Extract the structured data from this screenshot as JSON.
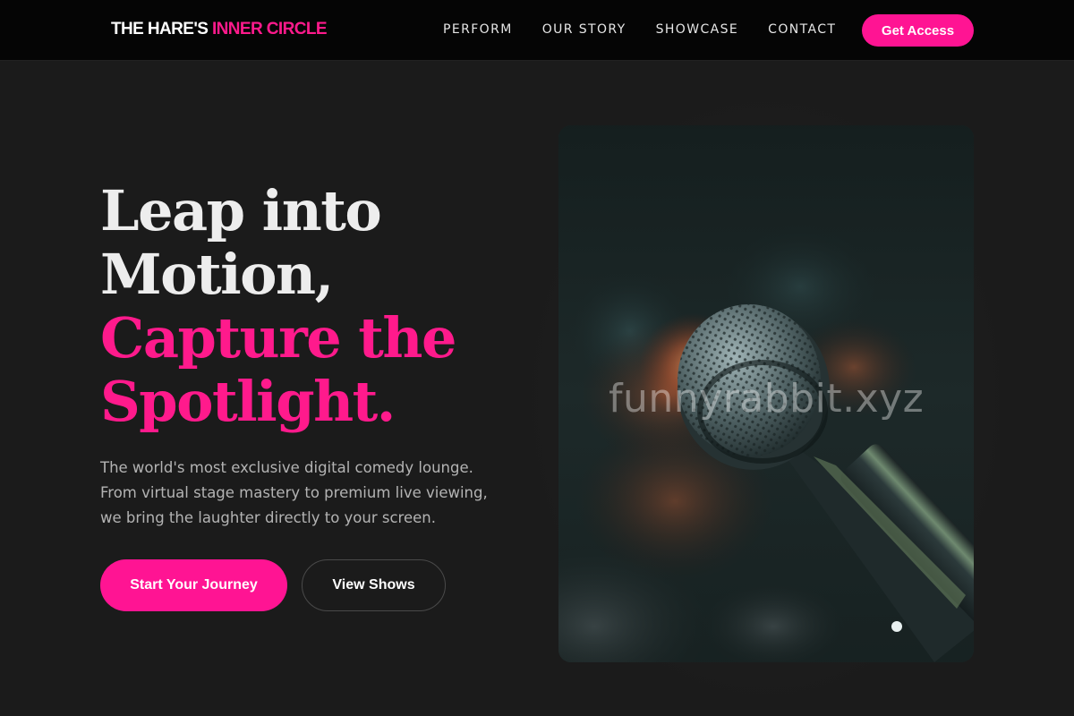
{
  "brand": {
    "name_part1": "THE HARE'S ",
    "name_part2": "INNER CIRCLE"
  },
  "nav": {
    "links": [
      {
        "label": "PERFORM"
      },
      {
        "label": "OUR STORY"
      },
      {
        "label": "SHOWCASE"
      },
      {
        "label": "CONTACT"
      }
    ],
    "cta_label": "Get Access"
  },
  "hero": {
    "headline_line1": "Leap into",
    "headline_line2": "Motion,",
    "headline_line3": "Capture the",
    "headline_line4": "Spotlight.",
    "subtitle_lines": [
      "The world's most exclusive digital comedy lounge.",
      "From virtual stage mastery to premium live viewing,",
      "we bring the laughter directly to your screen."
    ],
    "primary_button": "Start Your Journey",
    "secondary_button": "View Shows",
    "image_watermark": "funnyrabbit.xyz"
  },
  "colors": {
    "background": "#1b1b1b",
    "navbar": "#050505",
    "accent": "#ff1493",
    "headline": "#ededed",
    "subtitle": "#b3b3b3"
  },
  "icons": {
    "hero_image": "microphone-photo"
  }
}
